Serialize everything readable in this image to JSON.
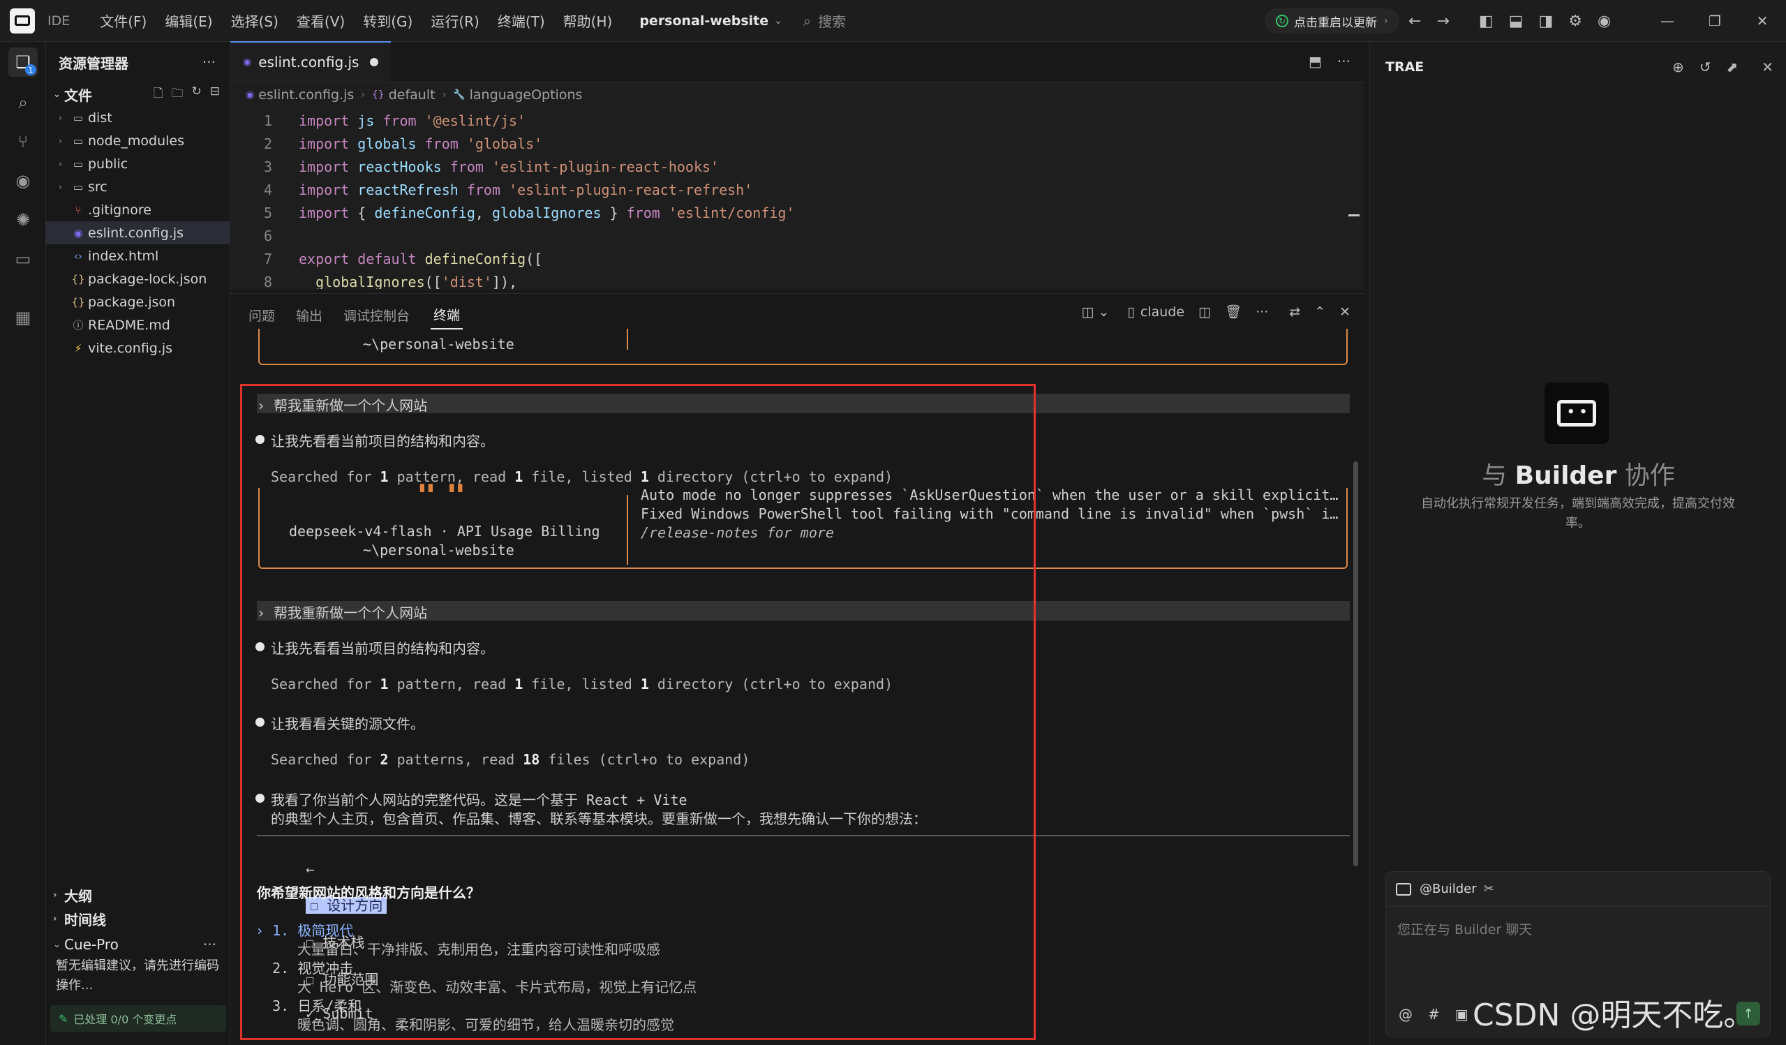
{
  "titlebar": {
    "ide_label": "IDE",
    "menus": [
      "文件(F)",
      "编辑(E)",
      "选择(S)",
      "查看(V)",
      "转到(G)",
      "运行(R)",
      "终端(T)",
      "帮助(H)"
    ],
    "project": "personal-website",
    "search_placeholder": "搜索",
    "update_label": "点击重启以更新",
    "icons": [
      "arrow-left-icon",
      "arrow-right-icon",
      "layout-left-icon",
      "layout-bottom-icon",
      "layout-right-icon",
      "gear-icon",
      "account-icon"
    ]
  },
  "explorer": {
    "title": "资源管理器",
    "section": "文件",
    "items": [
      {
        "name": "dist",
        "type": "folder"
      },
      {
        "name": "node_modules",
        "type": "folder"
      },
      {
        "name": "public",
        "type": "folder"
      },
      {
        "name": "src",
        "type": "folder"
      },
      {
        "name": ".gitignore",
        "type": "git"
      },
      {
        "name": "eslint.config.js",
        "type": "eslint",
        "selected": true
      },
      {
        "name": "index.html",
        "type": "html"
      },
      {
        "name": "package-lock.json",
        "type": "json"
      },
      {
        "name": "package.json",
        "type": "json"
      },
      {
        "name": "README.md",
        "type": "info"
      },
      {
        "name": "vite.config.js",
        "type": "vite"
      }
    ],
    "outline": "大纲",
    "timeline": "时间线",
    "cue_title": "Cue-Pro",
    "cue_body": "暂无编辑建议，请先进行编码操作...",
    "cue_footer": "已处理 0/0 个变更点"
  },
  "editor": {
    "tab": "eslint.config.js",
    "breadcrumb": [
      "eslint.config.js",
      "default",
      "languageOptions"
    ],
    "lines": [
      {
        "n": "1",
        "code": [
          [
            "kw",
            "import "
          ],
          [
            "id",
            "js "
          ],
          [
            "kw",
            "from "
          ],
          [
            "str",
            "'@eslint/js'"
          ]
        ]
      },
      {
        "n": "2",
        "code": [
          [
            "kw",
            "import "
          ],
          [
            "id",
            "globals "
          ],
          [
            "kw",
            "from "
          ],
          [
            "str",
            "'globals'"
          ]
        ]
      },
      {
        "n": "3",
        "code": [
          [
            "kw",
            "import "
          ],
          [
            "id",
            "reactHooks "
          ],
          [
            "kw",
            "from "
          ],
          [
            "str",
            "'eslint-plugin-react-hooks'"
          ]
        ]
      },
      {
        "n": "4",
        "code": [
          [
            "kw",
            "import "
          ],
          [
            "id",
            "reactRefresh "
          ],
          [
            "kw",
            "from "
          ],
          [
            "str",
            "'eslint-plugin-react-refresh'"
          ]
        ]
      },
      {
        "n": "5",
        "code": [
          [
            "kw",
            "import "
          ],
          [
            "pn",
            "{ "
          ],
          [
            "id",
            "defineConfig"
          ],
          [
            "pn",
            ", "
          ],
          [
            "id",
            "globalIgnores "
          ],
          [
            "pn",
            "} "
          ],
          [
            "kw",
            "from "
          ],
          [
            "str",
            "'eslint/config'"
          ]
        ]
      },
      {
        "n": "6",
        "code": []
      },
      {
        "n": "7",
        "code": [
          [
            "kw",
            "export default "
          ],
          [
            "fn",
            "defineConfig"
          ],
          [
            "pn",
            "(["
          ]
        ]
      },
      {
        "n": "8",
        "code": [
          [
            "pn",
            "  "
          ],
          [
            "fn",
            "globalIgnores"
          ],
          [
            "pn",
            "(["
          ],
          [
            "str",
            "'dist'"
          ],
          [
            "pn",
            "]),"
          ]
        ]
      }
    ]
  },
  "panel": {
    "tabs": [
      "问题",
      "输出",
      "调试控制台",
      "终端"
    ],
    "active_tab": "终端",
    "terminal_name": "claude"
  },
  "terminal": {
    "box1_path": "~\\personal-website",
    "prompt": "› 帮我重新做一个个人网站",
    "msg_look": "让我先看看当前项目的结构和内容。",
    "searched1": [
      "Searched for ",
      "1",
      " pattern, read ",
      "1",
      " file, listed ",
      "1",
      " directory (ctrl+o to expand)"
    ],
    "box2_logo": "▘▘ ▝▝",
    "box2_model": "deepseek-v4-flash · API Usage Billing",
    "box2_path": "~\\personal-website",
    "release1": "Auto mode no longer suppresses `AskUserQuestion` when the user or a skill explicit…",
    "release2": "Fixed Windows PowerShell tool failing with \"command line is invalid\" when `pwsh` i…",
    "release3": "/release-notes for more",
    "msg_source": "让我看看关键的源文件。",
    "searched2": [
      "Searched for ",
      "2",
      " patterns, read ",
      "18",
      " files (ctrl+o to expand)"
    ],
    "msg_summary1": "我看了你当前个人网站的完整代码。这是一个基于 React + Vite",
    "msg_summary2": "的典型个人主页，包含首页、作品集、博客、联系等基本模块。要重新做一个，我想先确认一下你的想法：",
    "nav_prev": "←",
    "nav_tabs": [
      "☐ 设计方向",
      "☐ 技术栈",
      "☐ 功能范围",
      "✓ Submit"
    ],
    "nav_next": "→",
    "question": "你希望新网站的风格和方向是什么？",
    "options": [
      {
        "label": "› 1. 极简现代",
        "desc": "大量留白、干净排版、克制用色，注重内容可读性和呼吸感"
      },
      {
        "label": "  2. 视觉冲击",
        "desc": "大 Hero 区、渐变色、动效丰富、卡片式布局，视觉上有记忆点"
      },
      {
        "label": "  3. 日系/柔和",
        "desc": "暖色调、圆角、柔和阴影、可爱的细节，给人温暖亲切的感觉"
      }
    ]
  },
  "trae": {
    "title": "TRAE",
    "heading_prefix": "与 ",
    "heading_name": "Builder",
    "heading_suffix": " 协作",
    "description": "自动化执行常规开发任务，端到端高效完成，提高交付效率。",
    "agent": "@Builder",
    "input_placeholder": "您正在与 Builder 聊天",
    "watermark": "CSDN @明天不吃。"
  },
  "colors": {
    "accent": "#5b8def",
    "terminal_box": "#d98a4a",
    "red_annotation": "#e0342c",
    "success": "#34c26a"
  }
}
